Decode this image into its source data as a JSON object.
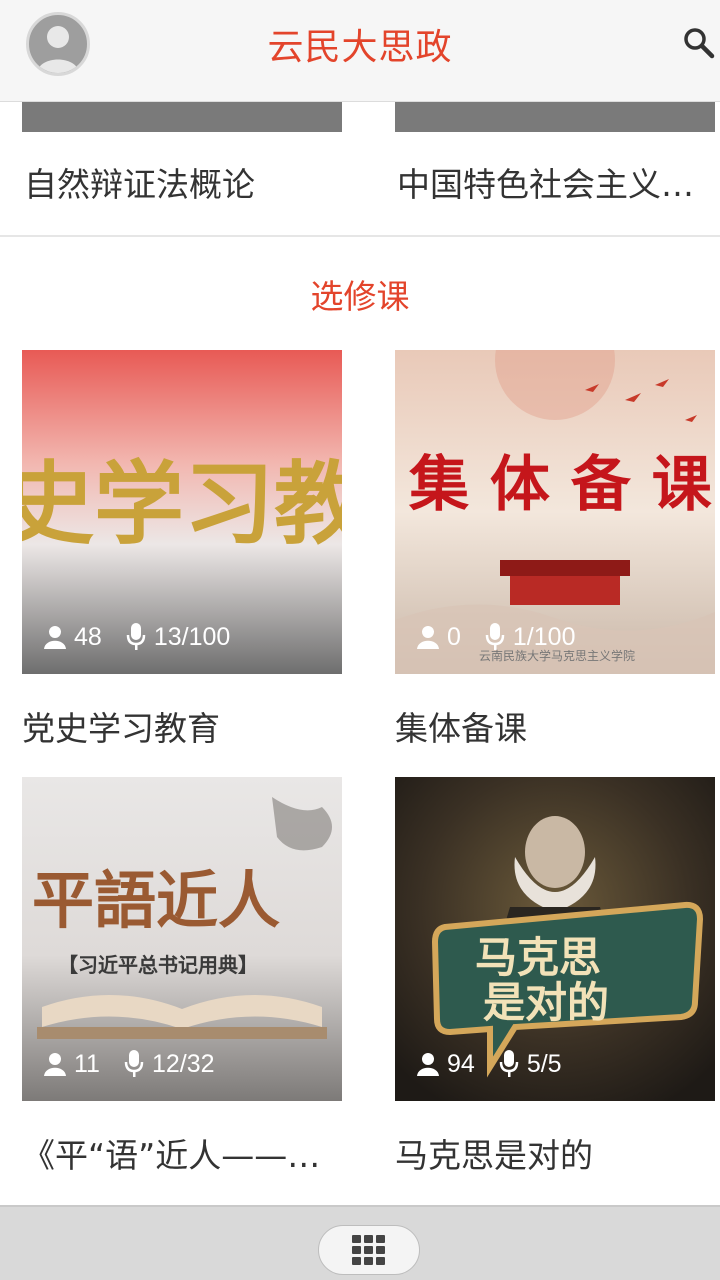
{
  "header": {
    "title": "云民大思政"
  },
  "top_row": [
    {
      "title": "自然辩证法概论"
    },
    {
      "title": "中国特色社会主义…"
    }
  ],
  "section": {
    "title": "选修课"
  },
  "courses": [
    {
      "title": "党史学习教育",
      "thumb_text": "史学习教育",
      "students": "48",
      "lessons": "13/100"
    },
    {
      "title": "集体备课",
      "thumb_text": "集 体 备 课",
      "thumb_caption": "云南民族大学马克思主义学院",
      "students": "0",
      "lessons": "1/100"
    },
    {
      "title": "《平“语”近人——习…",
      "thumb_text": "平語近人",
      "thumb_subtext": "【习近平总书记用典】",
      "students": "11",
      "lessons": "12/32"
    },
    {
      "title": "马克思是对的",
      "thumb_text_line1": "马克思",
      "thumb_text_line2": "是对的",
      "students": "94",
      "lessons": "5/5"
    }
  ],
  "colors": {
    "accent": "#e3442b",
    "header_bg": "#f6f6f6",
    "bottom_bar_bg": "#d9d9d9"
  },
  "icons": {
    "avatar": "user-avatar-icon",
    "search": "search-icon",
    "student": "person-icon",
    "lesson": "microphone-icon",
    "menu": "grid-menu-icon"
  }
}
